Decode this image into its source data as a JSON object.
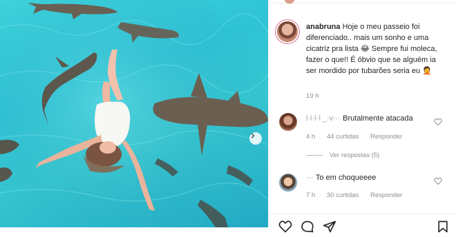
{
  "post": {
    "username": "anabruna",
    "caption": "Hoje o meu passeio foi diferenciado.. mais um sonho e uma cicatriz pra lista 😂 Sempre fui moleca, fazer o que!! É óbvio que se alguém ia ser mordido por tubarões seria eu 🤦",
    "time": "19 h"
  },
  "comments": [
    {
      "username": "l·l·l·l _·v···",
      "text": "Brutalmente atacada",
      "time": "4 h",
      "likes": "44 curtidas",
      "reply": "Responder"
    },
    {
      "username": "·-·",
      "text": "To em choqueeee",
      "time": "7 h",
      "likes": "30 curtidas",
      "reply": "Responder"
    }
  ],
  "view_replies": "Ver respostas (5)",
  "icons": {
    "carousel": "chevron-right-icon",
    "like": "heart-icon",
    "comment": "comment-icon",
    "share": "send-icon",
    "save": "bookmark-icon"
  },
  "colors": {
    "water": "#2fc3d6",
    "story_ring": "#dc6b8d",
    "muted_text": "#8e8e8e"
  }
}
